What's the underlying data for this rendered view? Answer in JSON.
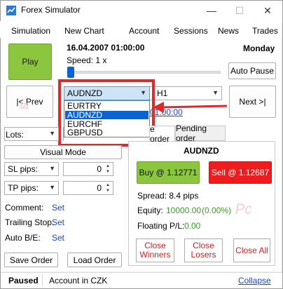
{
  "window": {
    "title": "Forex Simulator",
    "minimize_glyph": "—",
    "maximize_glyph": "☐",
    "close_glyph": "✕"
  },
  "menu": [
    "Simulation",
    "New Chart",
    "Account",
    "Sessions",
    "News",
    "Trades"
  ],
  "header": {
    "datetime": "16.04.2007 01:00:00",
    "weekday": "Monday",
    "speed": "Speed: 1 x"
  },
  "buttons": {
    "play": "Play",
    "auto_pause": "Auto Pause",
    "prev": "|< Prev",
    "next": "Next >|",
    "visual_mode": "Visual Mode",
    "save_order": "Save Order",
    "load_order": "Load Order",
    "buy": "Buy @ 1.12771",
    "sell": "Sell @ 1.12687",
    "close_winners": "Close\nWinners",
    "close_losers": "Close\nLosers",
    "close_all": "Close All"
  },
  "symbol_combo": {
    "value": "AUDNZD",
    "options": [
      "EURTRY",
      "AUDNZD",
      "EURCHF",
      "GBPUSD"
    ],
    "selected_index": 1
  },
  "timeframe_combo": {
    "value": "H1"
  },
  "timestamp_link": "01:00:00",
  "left_panel": {
    "lots_label": "Lots:",
    "lots_value": "",
    "sl_label": "SL pips:",
    "sl_value": "0",
    "tp_label": "TP pips:",
    "tp_value": "0",
    "comment_label": "Comment:",
    "comment_link": "Set",
    "trailing_label": "Trailing Stop:",
    "trailing_link": "Set",
    "autobe_label": "Auto B/E:",
    "autobe_link": "Set"
  },
  "tabs": [
    "e order",
    "Pending order"
  ],
  "order_panel": {
    "symbol": "AUDNZD",
    "spread": "Spread: 8.4 pips",
    "equity_label": "Equity:",
    "equity_value": "10000.00",
    "equity_pct": "(0.00%)",
    "floating_label": "Floating P/L:",
    "floating_value": "0.00"
  },
  "status": {
    "state": "Paused",
    "account": "Account in CZK",
    "collapse": "Collapse"
  },
  "colors": {
    "accent_green": "#8cc63f",
    "sell_red": "#ee1c1c",
    "annotation_red": "#e02a2a",
    "link_blue": "#1a47c7",
    "selection_blue": "#0a64d6"
  }
}
